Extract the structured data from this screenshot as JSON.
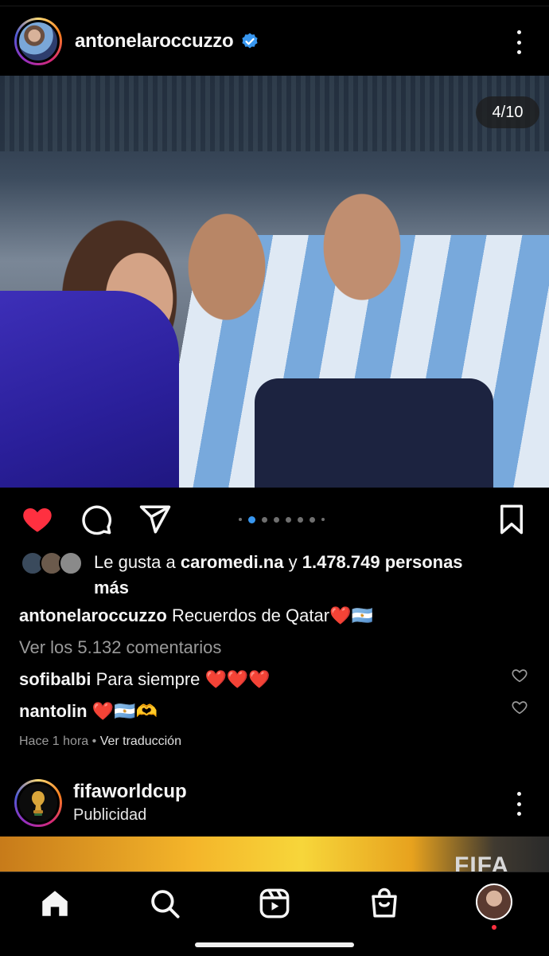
{
  "post": {
    "username": "antonelaroccuzzo",
    "verified": true,
    "photo_counter": "4/10",
    "carousel": {
      "total_dots": 8,
      "active_index": 1
    },
    "likes": {
      "prefix": "Le gusta a",
      "user": "caromedi.na",
      "connector": "y",
      "count_text": "1.478.749 personas",
      "suffix": "más"
    },
    "caption": {
      "username": "antonelaroccuzzo",
      "text": "Recuerdos de Qatar❤️🇦🇷"
    },
    "view_comments": "Ver los 5.132 comentarios",
    "comments": [
      {
        "username": "sofibalbi",
        "text": "Para siempre ❤️❤️❤️"
      },
      {
        "username": "nantolin",
        "text": "❤️🇦🇷🫶"
      }
    ],
    "time": "Hace 1 hora",
    "separator": "•",
    "translate": "Ver traducción"
  },
  "ad": {
    "username": "fifaworldcup",
    "label": "Publicidad",
    "image_text": "FIFA"
  },
  "nav": {
    "items": [
      "home-icon",
      "search-icon",
      "reels-icon",
      "shop-icon",
      "profile-avatar"
    ]
  },
  "colors": {
    "background": "#000000",
    "like_red": "#ff3040",
    "verified_blue": "#3897f0",
    "muted_text": "#9a9a9a"
  }
}
